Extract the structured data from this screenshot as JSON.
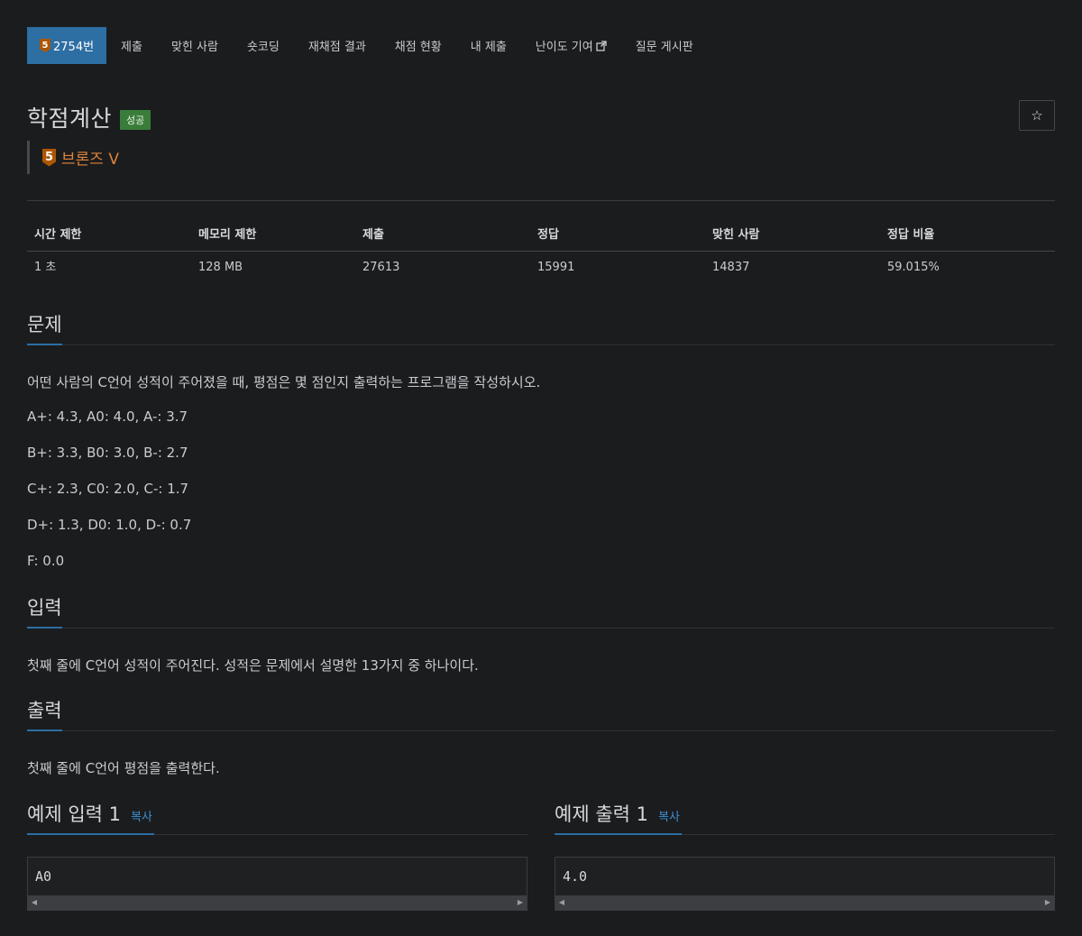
{
  "tabs": [
    {
      "label": "2754번",
      "tier_num": "5"
    },
    {
      "label": "제출"
    },
    {
      "label": "맞힌 사람"
    },
    {
      "label": "숏코딩"
    },
    {
      "label": "재채점 결과"
    },
    {
      "label": "채점 현황"
    },
    {
      "label": "내 제출"
    },
    {
      "label": "난이도 기여"
    },
    {
      "label": "질문 게시판"
    }
  ],
  "problem": {
    "title": "학점계산",
    "status_badge": "성공",
    "tier_num": "5",
    "tier_name": "브론즈 V",
    "star_icon": "star-icon"
  },
  "stats": {
    "headers": [
      "시간 제한",
      "메모리 제한",
      "제출",
      "정답",
      "맞힌 사람",
      "정답 비율"
    ],
    "values": [
      "1 초",
      "128 MB",
      "27613",
      "15991",
      "14837",
      "59.015%"
    ]
  },
  "sections": {
    "problem_heading": "문제",
    "problem_lines": [
      "어떤 사람의 C언어 성적이 주어졌을 때, 평점은 몇 점인지 출력하는 프로그램을 작성하시오.",
      "A+: 4.3, A0: 4.0, A-: 3.7",
      "B+: 3.3, B0: 3.0, B-: 2.7",
      "C+: 2.3, C0: 2.0, C-: 1.7",
      "D+: 1.3, D0: 1.0, D-: 0.7",
      "F: 0.0"
    ],
    "input_heading": "입력",
    "input_text": "첫째 줄에 C언어 성적이 주어진다. 성적은 문제에서 설명한 13가지 중 하나이다.",
    "output_heading": "출력",
    "output_text": "첫째 줄에 C언어 평점을 출력한다."
  },
  "samples": {
    "input_title": "예제 입력 1",
    "output_title": "예제 출력 1",
    "copy_label": "복사",
    "input_value": "A0",
    "output_value": "4.0"
  },
  "colors": {
    "background": "#1b1c1e",
    "active_tab": "#2d6ea3",
    "bronze": "#ad5600",
    "success_badge": "#3a7d3a",
    "link": "#3d8fd1"
  }
}
